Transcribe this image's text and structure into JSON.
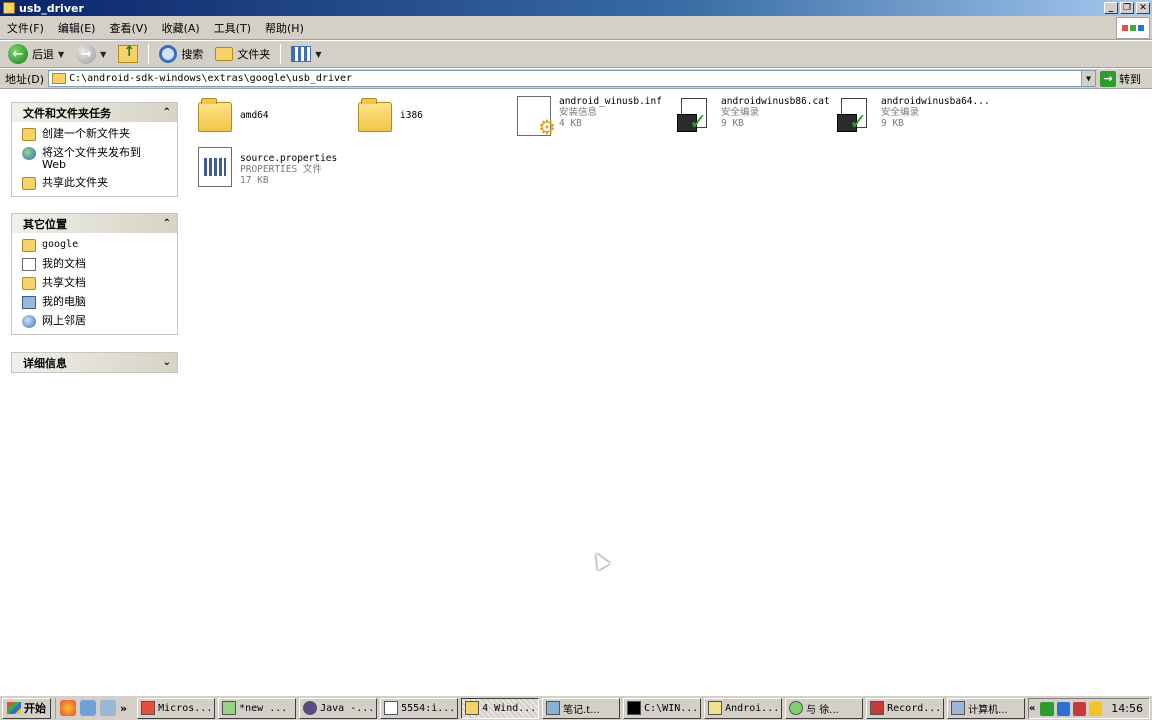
{
  "window": {
    "title": "usb_driver",
    "minimize": "_",
    "maximize": "❐",
    "close": "✕"
  },
  "menu": [
    "文件(F)",
    "编辑(E)",
    "查看(V)",
    "收藏(A)",
    "工具(T)",
    "帮助(H)"
  ],
  "toolbar": {
    "back_label": "后退",
    "search_label": "搜索",
    "folders_label": "文件夹"
  },
  "address": {
    "label": "地址(D)",
    "path": "C:\\android-sdk-windows\\extras\\google\\usb_driver",
    "go_label": "转到"
  },
  "taskpane": {
    "file_tasks": {
      "title": "文件和文件夹任务",
      "items": [
        "创建一个新文件夹",
        "将这个文件夹发布到 Web",
        "共享此文件夹"
      ]
    },
    "other_places": {
      "title": "其它位置",
      "items": [
        "google",
        "我的文档",
        "共享文档",
        "我的电脑",
        "网上邻居"
      ]
    },
    "details": {
      "title": "详细信息"
    }
  },
  "files": [
    {
      "name": "amd64",
      "type": "",
      "size": "",
      "icon": "folder-icon"
    },
    {
      "name": "i386",
      "type": "",
      "size": "",
      "icon": "folder-icon"
    },
    {
      "name": "android_winusb.inf",
      "type": "安装信息",
      "size": "4 KB",
      "icon": "inf-file-icon"
    },
    {
      "name": "androidwinusb86.cat",
      "type": "安全编录",
      "size": "9 KB",
      "icon": "catalog-file-icon"
    },
    {
      "name": "androidwinusba64...",
      "type": "安全编录",
      "size": "9 KB",
      "icon": "catalog-file-icon"
    },
    {
      "name": "source.properties",
      "type": "PROPERTIES 文件",
      "size": "17 KB",
      "icon": "properties-file-icon"
    }
  ],
  "taskbar": {
    "start_label": "开始",
    "quicklaunch_more": "»",
    "tasks": [
      "Micros...",
      "*new ...",
      "Java -...",
      "5554:i...",
      "4 Wind...",
      "笔记.t...",
      "C:\\WIN...",
      "Androi...",
      "与 徐...",
      "Record...",
      "计算机..."
    ],
    "tray_chev": "«",
    "clock": "14:56"
  }
}
